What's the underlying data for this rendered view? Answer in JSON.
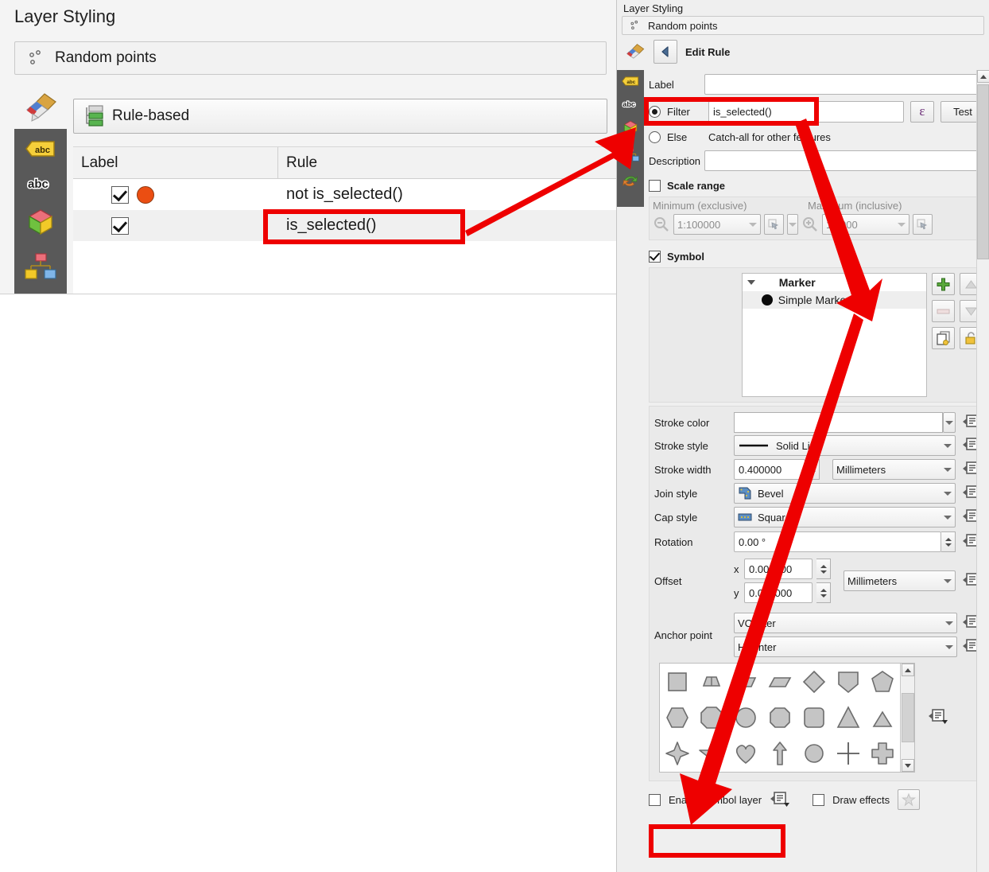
{
  "app": {
    "panel_title": "Layer Styling",
    "layer_name": "Random points"
  },
  "left_panel": {
    "title": "Layer Styling",
    "layer_name": "Random points",
    "renderer": "Rule-based",
    "table": {
      "columns": [
        "Label",
        "Rule"
      ],
      "rows": [
        {
          "checked": "true",
          "label": "",
          "rule": "not is_selected()",
          "has_symbol": "true"
        },
        {
          "checked": "true",
          "label": "",
          "rule": "is_selected()",
          "has_symbol": "false"
        }
      ]
    }
  },
  "right_panel": {
    "title": "Layer Styling",
    "layer_name": "Random points",
    "section_title": "Edit Rule",
    "back_icon": "back-arrow-icon",
    "fields": {
      "label_caption": "Label",
      "label_value": "",
      "filter_caption": "Filter",
      "filter_value": "is_selected()",
      "filter_selected": "true",
      "expression_button": "ε",
      "test_button": "Test",
      "else_caption": "Else",
      "else_hint": "Catch-all for other features",
      "description_caption": "Description",
      "description_value": ""
    },
    "scale_range": {
      "caption": "Scale range",
      "enabled": "false",
      "minimum_caption": "Minimum (exclusive)",
      "minimum_value": "1:100000",
      "maximum_caption": "Maximum (inclusive)",
      "maximum_value": "1:1000"
    },
    "symbol": {
      "caption": "Symbol",
      "enabled": "true",
      "tree": [
        {
          "name": "Marker",
          "type": "group"
        },
        {
          "name": "Simple Marker",
          "type": "layer"
        }
      ],
      "buttons": [
        "add-symbol-layer-button",
        "move-up-button",
        "remove-symbol-layer-button",
        "move-down-button",
        "duplicate-symbol-layer-button",
        "lock-layer-button"
      ]
    },
    "properties": [
      {
        "label": "Stroke color",
        "value": "",
        "kind": "color"
      },
      {
        "label": "Stroke style",
        "value": "Solid Line",
        "kind": "linestyle"
      },
      {
        "label": "Stroke width",
        "value": "0.400000",
        "unit": "Millimeters",
        "kind": "spin-unit"
      },
      {
        "label": "Join style",
        "value": "Bevel",
        "kind": "icon-combo"
      },
      {
        "label": "Cap style",
        "value": "Square",
        "kind": "icon-combo"
      },
      {
        "label": "Rotation",
        "value": "0.00 °",
        "kind": "spin"
      }
    ],
    "offset": {
      "label": "Offset",
      "x_caption": "x",
      "x_value": "0.000000",
      "y_caption": "y",
      "y_value": "0.000000",
      "unit": "Millimeters"
    },
    "anchor": {
      "label": "Anchor point",
      "vertical": "VCenter",
      "horizontal": "HCenter"
    },
    "shapes": [
      "square",
      "trapezoid-narrow",
      "trapezoid",
      "parallelogram",
      "diamond",
      "pentagon-flat",
      "pentagon",
      "hexagon",
      "octagon",
      "circle-rough",
      "octagon-rounded",
      "rounded-square",
      "triangle",
      "triangle-small",
      "four-point-star",
      "star",
      "heart",
      "arrow-up",
      "circle",
      "cross",
      "thick-cross"
    ],
    "footer": {
      "enable_symbol_layer_caption": "Enable symbol layer",
      "enable_symbol_layer_checked": "false",
      "draw_effects_caption": "Draw effects",
      "draw_effects_checked": "false",
      "effects_button": "effects-star-icon"
    },
    "sidebar_icons": [
      "symbology-brush-icon",
      "labels-abc-icon",
      "masks-abc-icon",
      "3d-view-cube-icon",
      "diagrams-icon",
      "history-undo-icon"
    ]
  },
  "annotations": {
    "highlight_color": "#ee0000",
    "boxes": [
      "rule-is-selected-highlight",
      "filter-row-highlight",
      "enable-symbol-layer-highlight"
    ],
    "arrows": [
      "arrow-rule-to-filter",
      "arrow-filter-to-simple-marker",
      "arrow-marker-to-enable-symbol-layer"
    ]
  }
}
